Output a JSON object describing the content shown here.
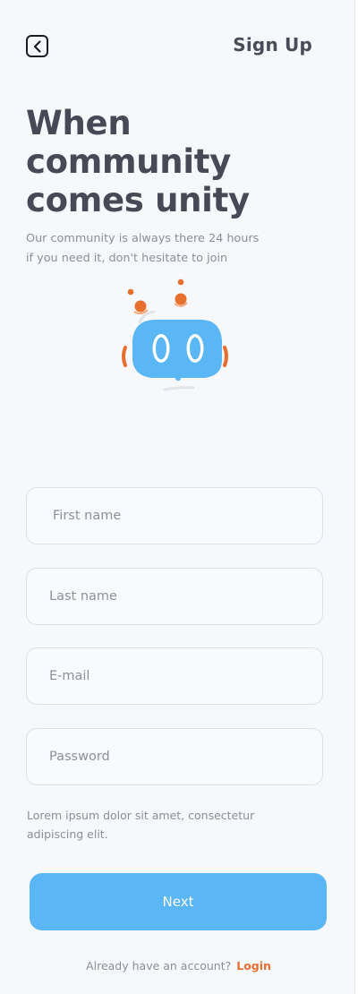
{
  "header": {
    "title": "Sign Up",
    "back_icon": "chevron-left-icon"
  },
  "hero": {
    "title_lines": [
      "When",
      "community",
      "comes unity"
    ],
    "subtitle_lines": [
      "Our community is always there 24 hours",
      "if you need it, don't hesitate to join"
    ],
    "illustration": "robot-mascot-icon"
  },
  "form": {
    "first_name_placeholder": "First name",
    "last_name_placeholder": "Last name",
    "email_placeholder": "E-mail",
    "password_placeholder": "Password",
    "note_lines": [
      "Lorem ipsum dolor sit amet, consectetur",
      "adipiscing elit."
    ],
    "next_label": "Next"
  },
  "footer": {
    "prompt": "Already have an account?",
    "login_label": "Login"
  },
  "colors": {
    "background": "#f7f8fc",
    "primary": "#5ab6f4",
    "accent": "#e8702f",
    "heading": "#474956"
  }
}
